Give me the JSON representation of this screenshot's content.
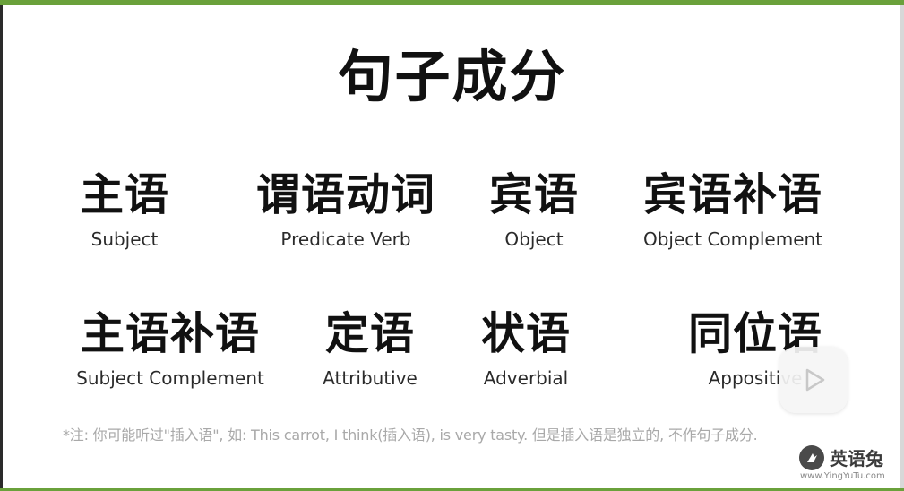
{
  "slide": {
    "title": "句子成分",
    "row1": [
      {
        "zh": "主语",
        "en": "Subject"
      },
      {
        "zh": "谓语动词",
        "en": "Predicate Verb"
      },
      {
        "zh": "宾语",
        "en": "Object"
      },
      {
        "zh": "宾语补语",
        "en": "Object Complement"
      }
    ],
    "row2": [
      {
        "zh": "主语补语",
        "en": "Subject Complement"
      },
      {
        "zh": "定语",
        "en": "Attributive"
      },
      {
        "zh": "状语",
        "en": "Adverbial"
      },
      {
        "zh": "同位语",
        "en": "Appositive"
      }
    ],
    "note": "*注: 你可能听过\"插入语\", 如: This carrot, I think(插入语), is very tasty. 但是插入语是独立的, 不作句子成分."
  },
  "logo": {
    "name": "英语兔",
    "url": "www.YingYuTu.com"
  },
  "colors": {
    "accent": "#6aa13b",
    "text": "#111111",
    "note": "#a9a9a9"
  },
  "icons": {
    "play": "play-icon",
    "logo": "rabbit-logo-icon"
  }
}
